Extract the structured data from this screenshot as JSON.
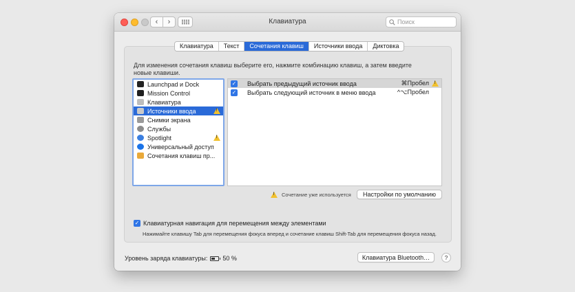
{
  "window": {
    "title": "Клавиатура"
  },
  "search": {
    "placeholder": "Поиск"
  },
  "tabs": [
    {
      "label": "Клавиатура"
    },
    {
      "label": "Текст"
    },
    {
      "label": "Сочетания клавиш",
      "active": true
    },
    {
      "label": "Источники ввода"
    },
    {
      "label": "Диктовка"
    }
  ],
  "description": "Для изменения сочетания клавиш выберите его, нажмите комбинацию клавиш, а затем введите новые клавиши.",
  "categories": [
    {
      "label": "Launchpad и Dock",
      "icon": "launchpad-icon"
    },
    {
      "label": "Mission Control",
      "icon": "mission-control-icon"
    },
    {
      "label": "Клавиатура",
      "icon": "keyboard-icon"
    },
    {
      "label": "Источники ввода",
      "icon": "input-sources-icon",
      "selected": true,
      "warning": true
    },
    {
      "label": "Снимки экрана",
      "icon": "screenshot-icon"
    },
    {
      "label": "Службы",
      "icon": "services-gear-icon"
    },
    {
      "label": "Spotlight",
      "icon": "spotlight-icon",
      "warning": true
    },
    {
      "label": "Универсальный доступ",
      "icon": "accessibility-icon"
    },
    {
      "label": "Сочетания клавиш пр...",
      "icon": "app-shortcuts-icon"
    }
  ],
  "shortcuts": [
    {
      "label": "Выбрать предыдущий источник ввода",
      "keys": "⌘Пробел",
      "checked": true,
      "warning": true
    },
    {
      "label": "Выбрать следующий источник в меню ввода",
      "keys": "^⌥Пробел",
      "checked": true,
      "warning": false
    }
  ],
  "conflict_note": "Сочетание уже используется",
  "restore_defaults_label": "Настройки по умолчанию",
  "keyboard_nav": {
    "label": "Клавиатурная навигация для перемещения между элементами",
    "checked": true,
    "hint": "Нажимайте клавишу Tab для перемещения фокуса вперед и сочетание клавиш Shift-Tab для перемещения фокуса назад."
  },
  "battery": {
    "label": "Уровень заряда клавиатуры:",
    "value": "50 %",
    "level_fraction": 0.5
  },
  "bluetooth_button": "Клавиатура Bluetooth…",
  "help_label": "?",
  "colors": {
    "accent": "#2a6ad8",
    "warning": "#f2c12e"
  }
}
